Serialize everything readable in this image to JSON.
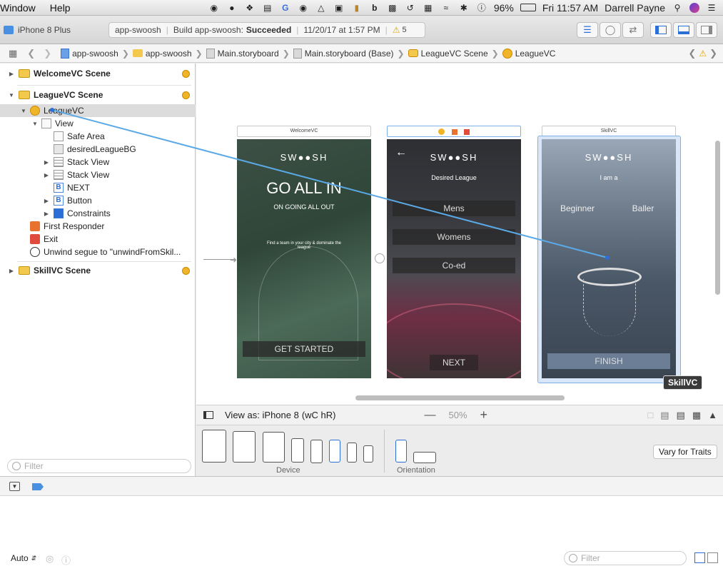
{
  "menubar": {
    "items": [
      "Window",
      "Help"
    ],
    "battery": "96%",
    "clock": "Fri 11:57 AM",
    "user": "Darrell Payne"
  },
  "toolbar": {
    "device": "iPhone 8 Plus",
    "project": "app-swoosh",
    "build_prefix": "Build app-swoosh:",
    "build_status": "Succeeded",
    "build_time": "11/20/17 at 1:57 PM",
    "warnings": "5"
  },
  "jumpbar": {
    "crumbs": [
      "app-swoosh",
      "app-swoosh",
      "Main.storyboard",
      "Main.storyboard (Base)",
      "LeagueVC Scene",
      "LeagueVC"
    ]
  },
  "outline": {
    "welcome_scene": "WelcomeVC Scene",
    "league_scene": "LeagueVC Scene",
    "league_vc": "LeagueVC",
    "view": "View",
    "safe_area": "Safe Area",
    "bg": "desiredLeagueBG",
    "stack1": "Stack View",
    "stack2": "Stack View",
    "next": "NEXT",
    "button": "Button",
    "constraints": "Constraints",
    "first_responder": "First Responder",
    "exit": "Exit",
    "unwind": "Unwind segue to \"unwindFromSkil...",
    "skill_scene": "SkillVC Scene",
    "filter_placeholder": "Filter"
  },
  "canvas": {
    "welcome": {
      "label": "WelcomeVC",
      "logo": "SW●●SH",
      "headline": "GO ALL IN",
      "subhead": "ON GOING ALL OUT",
      "body": "Find a team in your city & dominate the league",
      "cta": "GET STARTED"
    },
    "league": {
      "logo": "SW●●SH",
      "title": "Desired League",
      "options": [
        "Mens",
        "Womens",
        "Co-ed"
      ],
      "cta": "NEXT"
    },
    "skill": {
      "label": "SkillVC",
      "logo": "SW●●SH",
      "title": "I am a",
      "opt1": "Beginner",
      "opt2": "Baller",
      "cta": "FINISH",
      "tooltip": "SkillVC"
    }
  },
  "viewbar": {
    "view_as": "View as: iPhone 8",
    "traits": "(wC hR)",
    "zoom": "50%"
  },
  "devbar": {
    "device_label": "Device",
    "orientation_label": "Orientation",
    "vary": "Vary for Traits"
  },
  "debug": {
    "auto": "Auto",
    "filter_placeholder": "Filter"
  },
  "colors": {
    "accent": "#2b6fd6",
    "scene_yellow": "#f0b429",
    "segue_line": "#5aa9e6"
  }
}
